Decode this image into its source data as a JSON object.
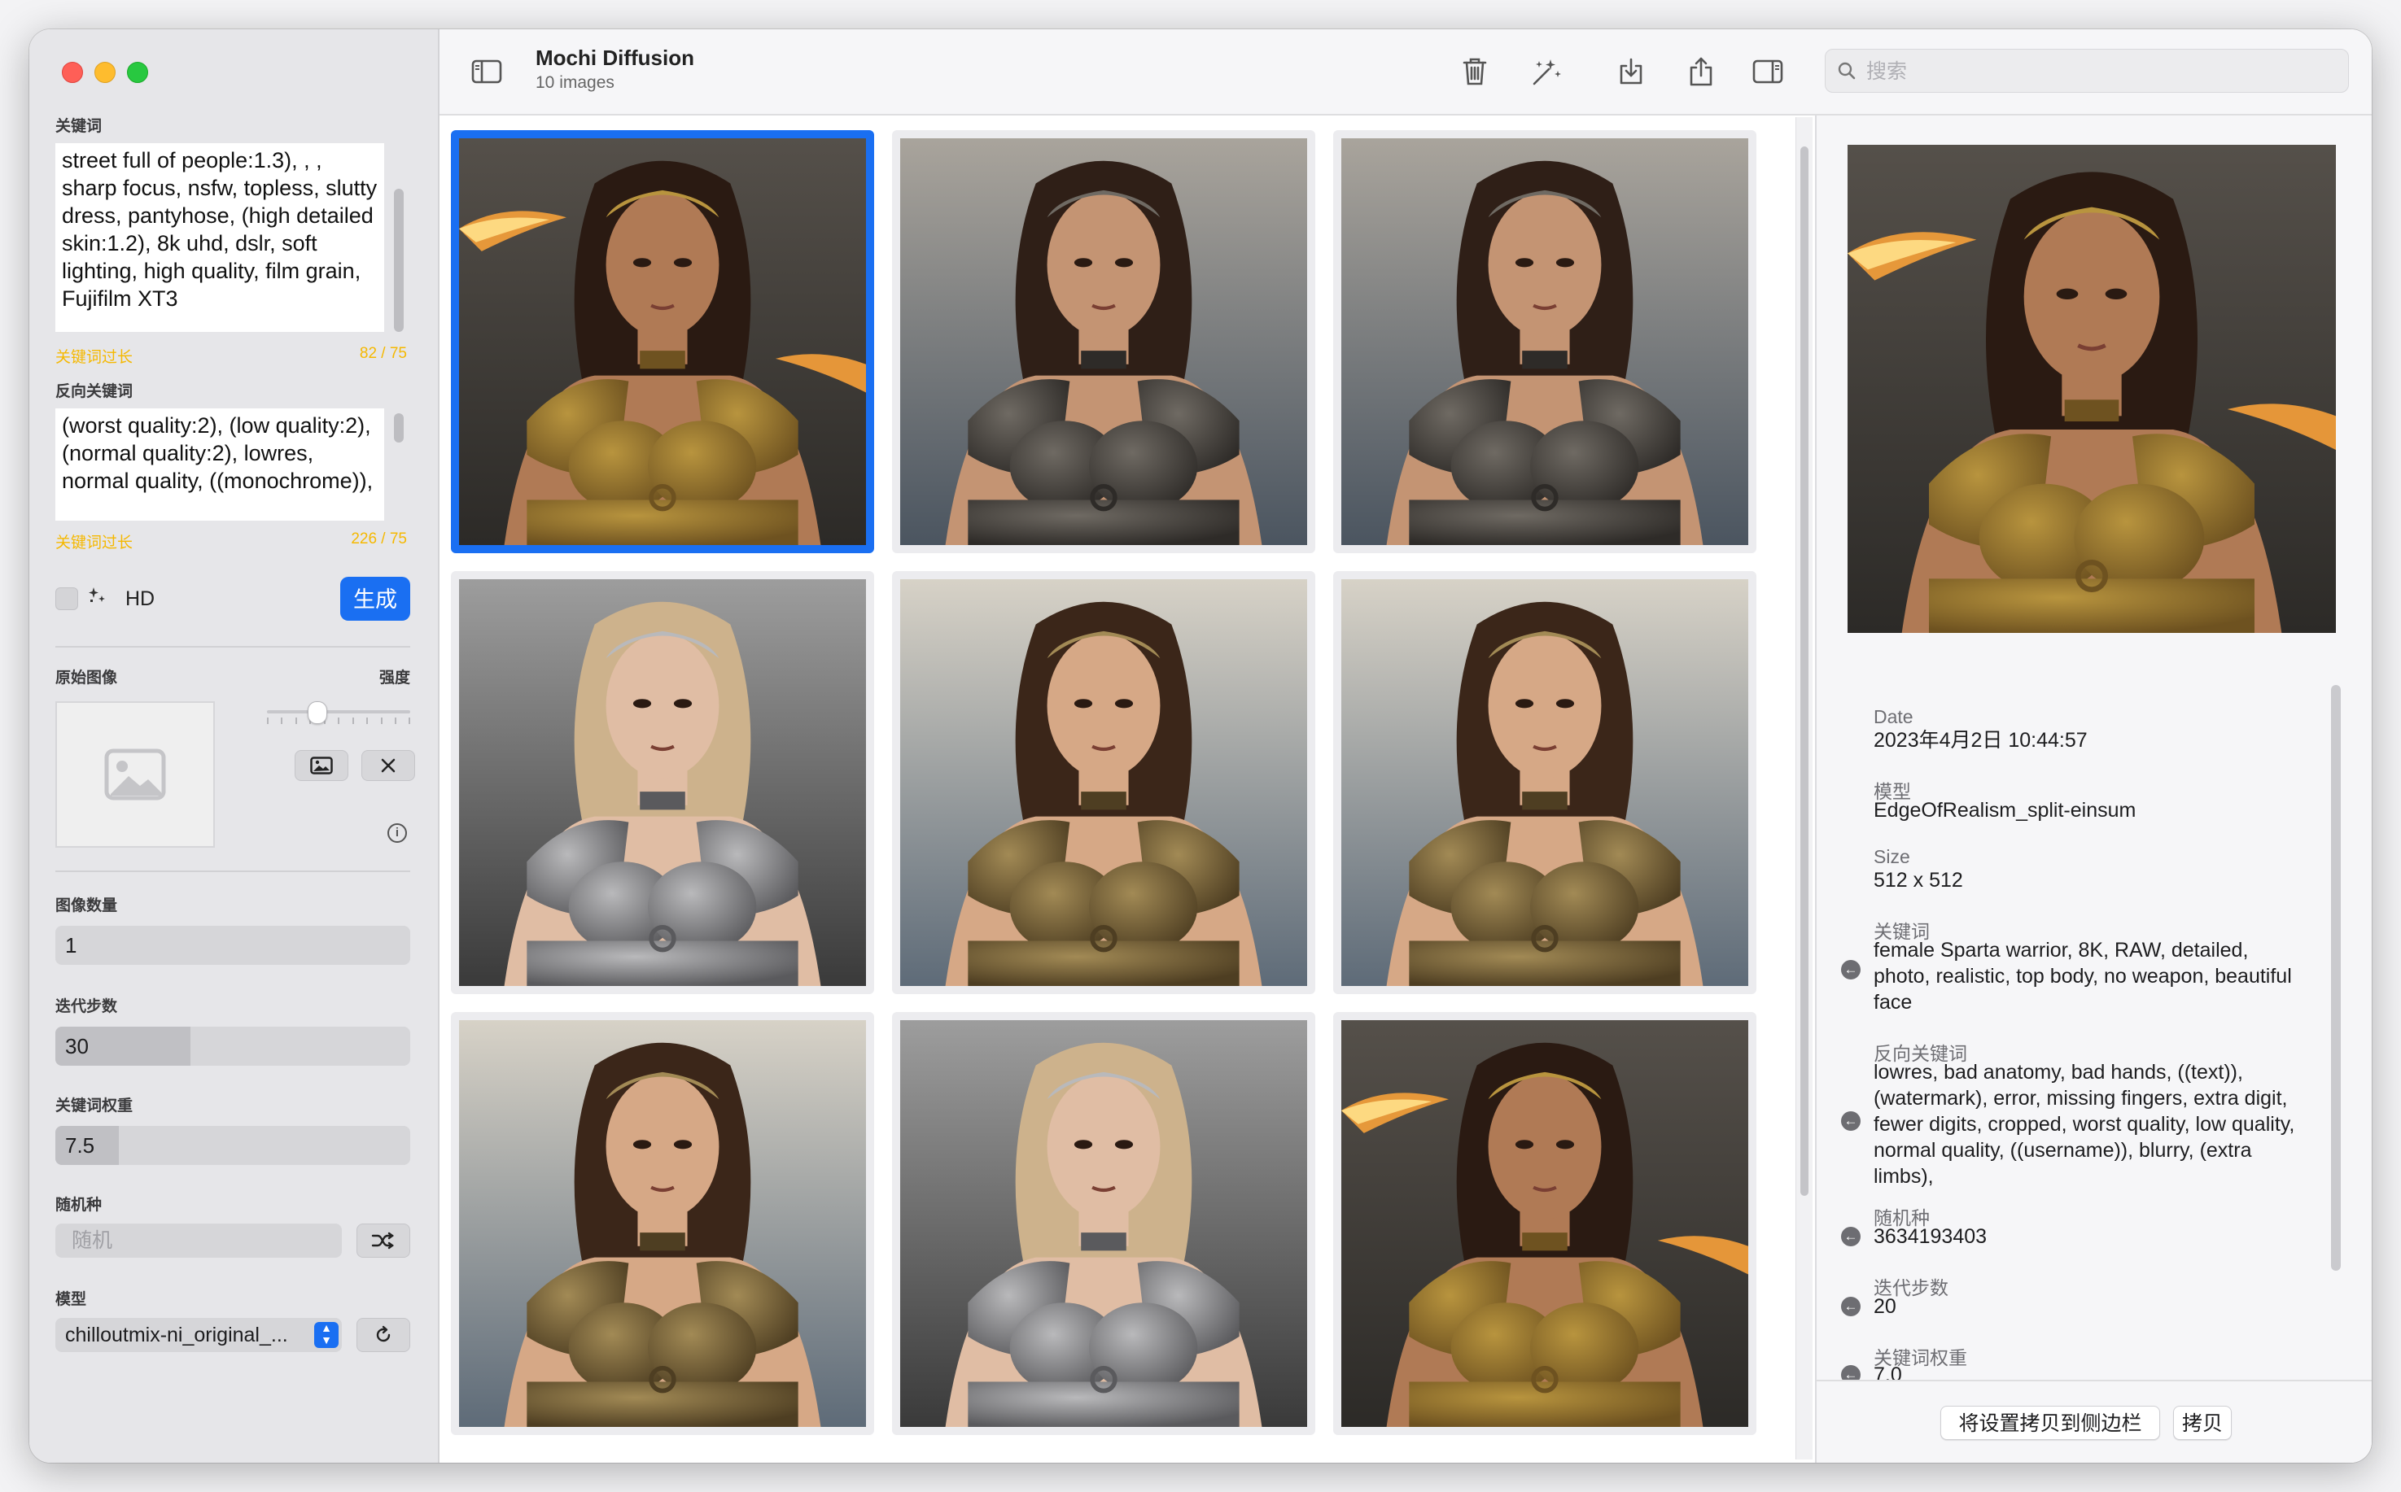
{
  "sidebar": {
    "prompt_label": "关键词",
    "prompt_text": "street full of people:1.3), , , sharp focus, nsfw, topless, slutty dress, pantyhose, (high detailed skin:1.2), 8k uhd, dslr, soft lighting, high quality, film grain, Fujifilm XT3",
    "prompt_warning": "关键词过长",
    "prompt_count": "82 / 75",
    "negative_label": "反向关键词",
    "negative_text": "(worst quality:2), (low quality:2), (normal quality:2), lowres, normal quality, ((monochrome)),",
    "negative_warning": "关键词过长",
    "negative_count": "226 / 75",
    "hd_label": "HD",
    "generate_label": "生成",
    "start_image_label": "原始图像",
    "strength_label": "强度",
    "image_count_label": "图像数量",
    "image_count_value": "1",
    "steps_label": "迭代步数",
    "steps_value": "30",
    "steps_fraction": 0.38,
    "guidance_label": "关键词权重",
    "guidance_value": "7.5",
    "guidance_fraction": 0.18,
    "seed_label": "随机种",
    "seed_placeholder": "随机",
    "model_label": "模型",
    "model_value": "chilloutmix-ni_original_..."
  },
  "toolbar": {
    "title": "Mochi Diffusion",
    "subtitle": "10 images",
    "search_placeholder": "搜索"
  },
  "gallery": {
    "images": [
      {
        "variant": "bronze",
        "selected": true
      },
      {
        "variant": "dark",
        "selected": false
      },
      {
        "variant": "dark",
        "selected": false
      },
      {
        "variant": "silver",
        "selected": false
      },
      {
        "variant": "gold",
        "selected": false
      },
      {
        "variant": "gold",
        "selected": false
      },
      {
        "variant": "gold",
        "selected": false
      },
      {
        "variant": "silver",
        "selected": false
      },
      {
        "variant": "bronze",
        "selected": false
      }
    ]
  },
  "inspector": {
    "date_label": "Date",
    "date_value": "2023年4月2日 10:44:57",
    "model_label": "模型",
    "model_value": "EdgeOfRealism_split-einsum",
    "size_label": "Size",
    "size_value": "512 x 512",
    "prompt_label": "关键词",
    "prompt_value": "female Sparta warrior, 8K, RAW, detailed, photo, realistic, top body, no weapon, beautiful face",
    "negative_label": "反向关键词",
    "negative_value": "lowres, bad anatomy, bad hands, ((text)), (watermark), error, missing fingers, extra digit, fewer digits, cropped, worst quality, low quality, normal quality, ((username)), blurry,  (extra limbs),",
    "seed_label": "随机种",
    "seed_value": "3634193403",
    "steps_label": "迭代步数",
    "steps_value": "20",
    "guidance_label": "关键词权重",
    "guidance_value": "7.0",
    "copy_to_sidebar_label": "将设置拷贝到侧边栏",
    "copy_label": "拷贝"
  },
  "colors": {
    "accent": "#1a6ff2",
    "warning": "#f5b800",
    "close": "#fe5f57",
    "minimize": "#febc2e",
    "zoom": "#28c840"
  }
}
